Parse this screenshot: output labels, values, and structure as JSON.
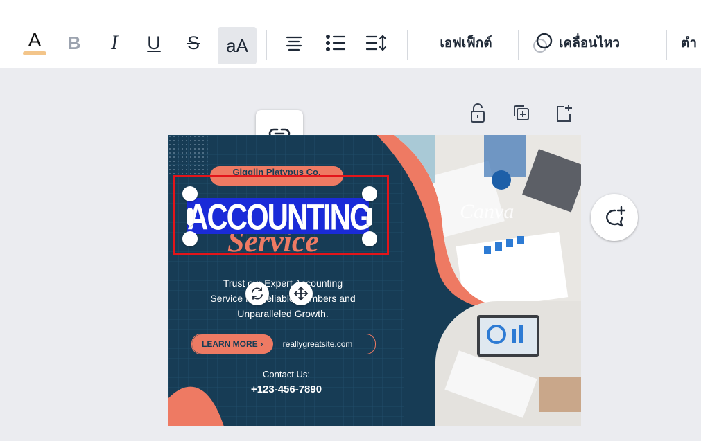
{
  "toolbar": {
    "text_color_glyph": "A",
    "bold_glyph": "B",
    "italic_glyph": "I",
    "underline_glyph": "U",
    "strike_glyph": "S",
    "case_label": "aA",
    "effects_label": "เอฟเฟ็กต์",
    "animate_label": "เคลื่อนไหว",
    "position_label_partial": "ตำ"
  },
  "design": {
    "company": "Gigglin Platypus Co.",
    "title": "ACCOUNTING",
    "subtitle": "Service",
    "body_line1": "Trust our Expert Accounting",
    "body_line2": "Service for Reliable Numbers and",
    "body_line3": "Unparalleled Growth.",
    "learn_more": "LEARN MORE",
    "website": "reallygreatsite.com",
    "contact_label": "Contact Us:",
    "phone": "+123-456-7890",
    "watermark": "Canva"
  },
  "colors": {
    "navy": "#173c55",
    "coral": "#ee7a63",
    "selection_red": "#e3151a",
    "selection_blue": "#1a2bd8",
    "toolbar_bg": "#ffffff",
    "canvas_bg": "#ebecf0"
  },
  "icons": [
    "text-color-icon",
    "bold-icon",
    "italic-icon",
    "underline-icon",
    "strikethrough-icon",
    "align-icon",
    "list-icon",
    "spacing-icon",
    "animate-icon",
    "link-icon",
    "lock-icon",
    "duplicate-icon",
    "add-page-icon",
    "comment-add-icon",
    "rotate-icon",
    "move-icon"
  ]
}
